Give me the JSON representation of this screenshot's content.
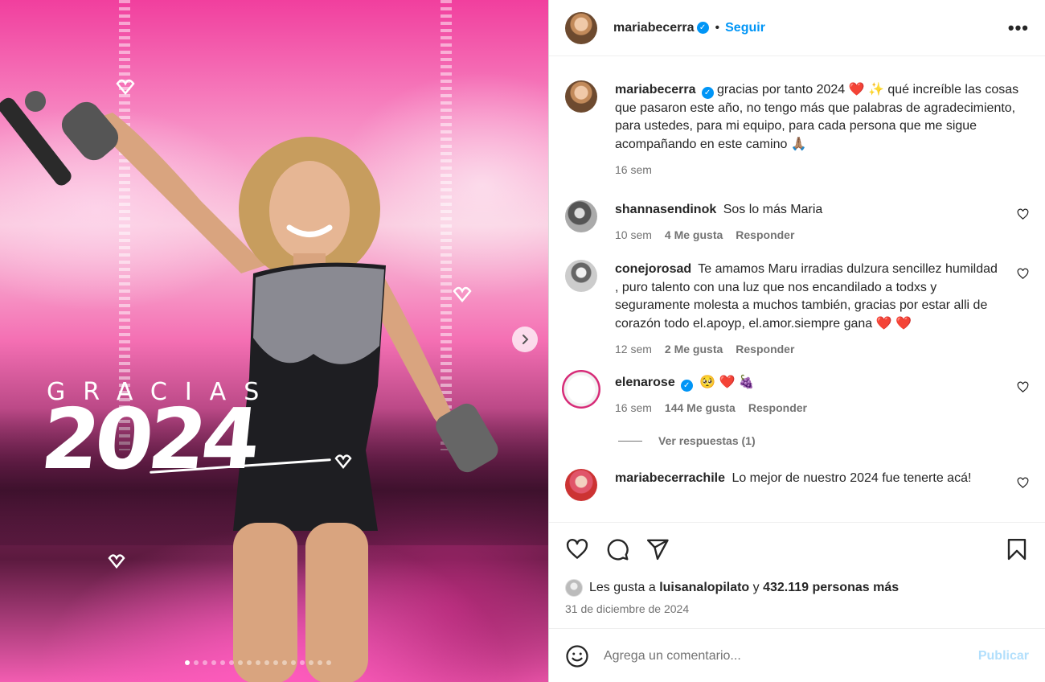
{
  "post": {
    "username": "mariabecerra",
    "bullet": "•",
    "follow_label": "Seguir",
    "more_label": "•••"
  },
  "media": {
    "overlay_word": "GRACIAS",
    "overlay_year": "2024",
    "slide_count": 17,
    "active_slide": 0
  },
  "caption": {
    "username": "mariabecerra",
    "text": "gracias por tanto 2024 ❤️ ✨ qué increíble las cosas que pasaron este año, no tengo más que palabras de agradecimiento, para ustedes, para mi equipo, para cada persona que me sigue acompañando en este camino 🙏🏽",
    "time": "16 sem"
  },
  "comments": [
    {
      "username": "shannasendinok",
      "text": "Sos lo más Maria",
      "time": "10 sem",
      "likes": "4 Me gusta",
      "reply": "Responder",
      "verified": false
    },
    {
      "username": "conejorosad",
      "text": "Te amamos Maru irradias dulzura sencillez humildad , puro talento con una luz que nos encandilado a todxs y seguramente molesta a muchos también, gracias por estar alli de corazón todo el.apoyp, el.amor.siempre gana ❤️ ❤️",
      "time": "12 sem",
      "likes": "2 Me gusta",
      "reply": "Responder",
      "verified": false
    },
    {
      "username": "elenarose",
      "text": "🥺 ❤️ 🍇",
      "time": "16 sem",
      "likes": "144 Me gusta",
      "reply": "Responder",
      "verified": true,
      "view_replies": "Ver respuestas (1)"
    },
    {
      "username": "mariabecerrachile",
      "text": "Lo mejor de nuestro 2024 fue tenerte acá!",
      "verified": false
    }
  ],
  "likes": {
    "prefix": "Les gusta a",
    "first_liker": "luisanalopilato",
    "connector": "y",
    "others": "432.119 personas más"
  },
  "date": "31 de diciembre de 2024",
  "comment_box": {
    "placeholder": "Agrega un comentario...",
    "publish_label": "Publicar"
  },
  "icons": [
    "heart-icon",
    "comment-icon",
    "share-icon",
    "bookmark-icon",
    "emoji-icon",
    "more-icon",
    "chevron-right-icon",
    "verified-icon"
  ]
}
